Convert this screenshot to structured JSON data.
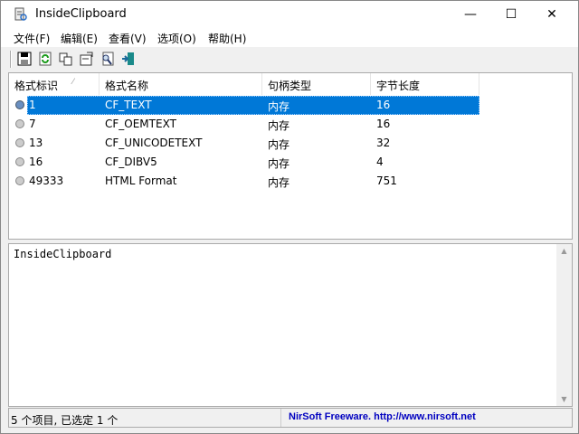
{
  "window": {
    "title": "InsideClipboard",
    "minimize": "—",
    "maximize": "☐",
    "close": "✕"
  },
  "menu": [
    "文件(F)",
    "编辑(E)",
    "查看(V)",
    "选项(O)",
    "帮助(H)"
  ],
  "toolbar": [
    "save-icon",
    "refresh-icon",
    "copy-icon",
    "properties-icon",
    "find-icon",
    "exit-icon"
  ],
  "columns": [
    "格式标识",
    "格式名称",
    "句柄类型",
    "字节长度"
  ],
  "sort_indicator": "⁄",
  "rows": [
    {
      "id": "1",
      "name": "CF_TEXT",
      "type": "内存",
      "size": "16",
      "selected": true
    },
    {
      "id": "7",
      "name": "CF_OEMTEXT",
      "type": "内存",
      "size": "16"
    },
    {
      "id": "13",
      "name": "CF_UNICODETEXT",
      "type": "内存",
      "size": "32"
    },
    {
      "id": "16",
      "name": "CF_DIBV5",
      "type": "内存",
      "size": "4"
    },
    {
      "id": "49333",
      "name": "HTML Format",
      "type": "内存",
      "size": "751"
    }
  ],
  "content": "InsideClipboard",
  "status": {
    "items": "5 个项目, 已选定 1 个",
    "credit": "NirSoft Freeware.  http://www.nirsoft.net"
  }
}
